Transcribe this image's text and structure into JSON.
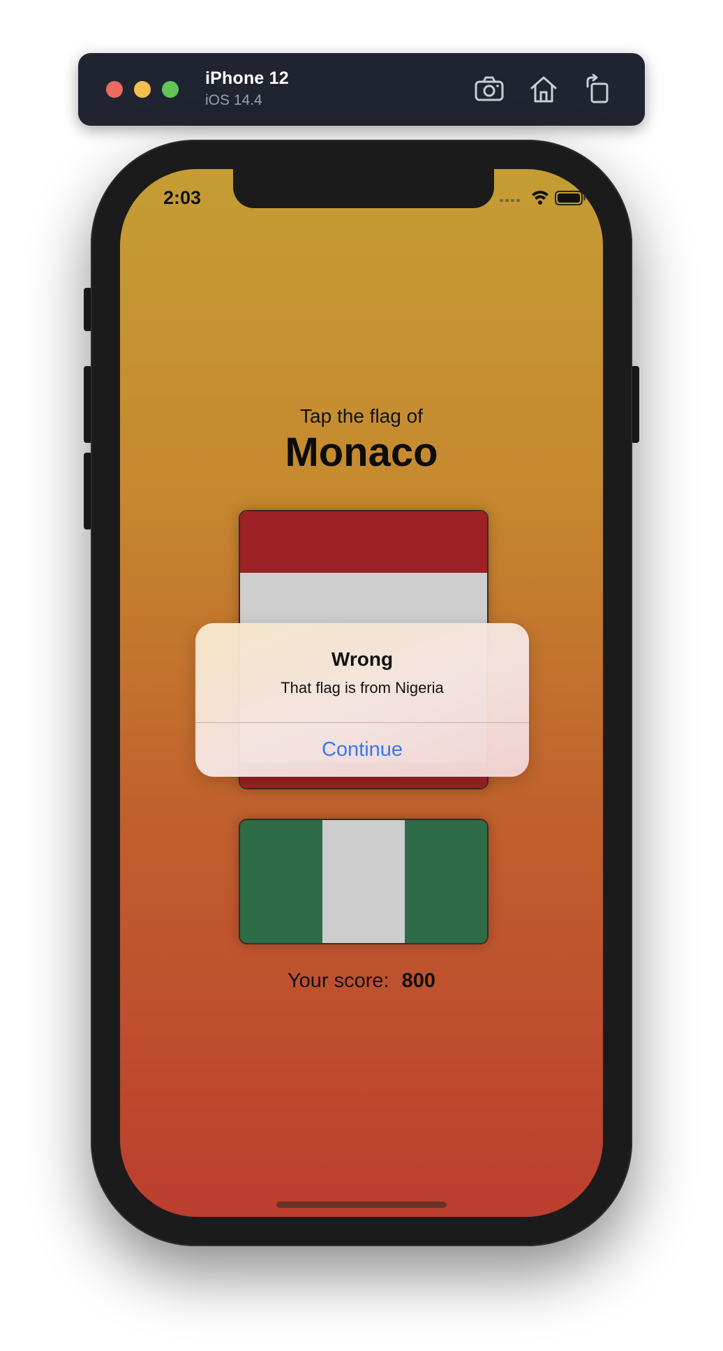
{
  "simulator": {
    "device_name": "iPhone 12",
    "os_version": "iOS 14.4",
    "icons": [
      "screenshot-icon",
      "home-icon",
      "rotate-icon"
    ]
  },
  "status_bar": {
    "time": "2:03",
    "icons": [
      "signal-icon",
      "wifi-icon",
      "battery-icon"
    ]
  },
  "game": {
    "prompt": "Tap the flag of",
    "country": "Monaco",
    "flags": [
      {
        "country": "Monaco",
        "colors": [
          "#9b2124",
          "#cecece"
        ]
      },
      {
        "country": "Nigeria",
        "colors": [
          "#2e6b47",
          "#cdcdcd",
          "#2e6b47"
        ]
      }
    ],
    "score_label": "Your score:",
    "score_value": "800"
  },
  "alert": {
    "title": "Wrong",
    "message": "That flag is from Nigeria",
    "button_label": "Continue",
    "button_color": "#3478f6"
  },
  "theme": {
    "gradient_top": "#c59d34",
    "gradient_bottom": "#bc3e2f"
  }
}
